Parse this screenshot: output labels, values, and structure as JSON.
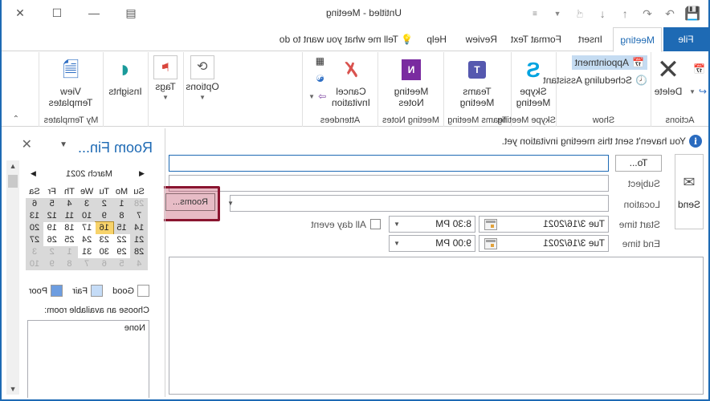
{
  "window": {
    "title": "Untitled  -  Meeting",
    "controls": [
      "restore-ribbon-icon",
      "minimize-icon",
      "maximize-icon",
      "close-icon"
    ]
  },
  "quick_access": [
    "save-icon",
    "redo-icon",
    "undo-icon",
    "up-icon",
    "down-icon",
    "touch-mode-icon",
    "customize-icon"
  ],
  "tabs": [
    {
      "label": "File"
    },
    {
      "label": "Meeting",
      "active": true
    },
    {
      "label": "Insert"
    },
    {
      "label": "Format Text"
    },
    {
      "label": "Review"
    },
    {
      "label": "Help"
    }
  ],
  "tell_me": "Tell me what you want to do",
  "ribbon": {
    "actions": {
      "label": "Actions",
      "delete": "Delete"
    },
    "show": {
      "label": "Show",
      "appointment": "Appointment",
      "scheduling": "Scheduling Assistant"
    },
    "skype": {
      "label": "Skype Meeting",
      "button": [
        "Skype",
        "Meeting"
      ]
    },
    "teams": {
      "label": "Teams Meeting",
      "button": [
        "Teams",
        "Meeting"
      ]
    },
    "notes": {
      "label": "Meeting Notes",
      "button": [
        "Meeting",
        "Notes"
      ]
    },
    "attendees": {
      "label": "Attendees",
      "cancel": [
        "Cancel",
        "Invitation"
      ]
    },
    "options": {
      "label": "Options"
    },
    "tags": {
      "label": "Tags"
    },
    "insights": {
      "label": "Insights"
    },
    "templates": {
      "label": "My Templates",
      "button": [
        "View",
        "Templates"
      ]
    }
  },
  "form": {
    "info": "You haven't sent this meeting invitation yet.",
    "send": "Send",
    "to_button": "To...",
    "to_value": "",
    "subject_label": "Subject",
    "subject_value": "",
    "location_label": "Location",
    "location_value": "",
    "rooms_button": "Rooms...",
    "start_label": "Start time",
    "start_date": "Tue 3/16/2021",
    "start_time": "8:30 PM",
    "end_label": "End time",
    "end_date": "Tue 3/16/2021",
    "end_time": "9:00 PM",
    "all_day_label": "All day event",
    "all_day": false,
    "body": ""
  },
  "room_finder": {
    "title": "Room Fin...",
    "month": "March 2021",
    "dow": [
      "Su",
      "Mo",
      "Tu",
      "We",
      "Th",
      "Fr",
      "Sa"
    ],
    "weeks": [
      [
        "28",
        "1",
        "2",
        "3",
        "4",
        "5",
        "6"
      ],
      [
        "7",
        "8",
        "9",
        "10",
        "11",
        "12",
        "13"
      ],
      [
        "14",
        "15",
        "16",
        "17",
        "18",
        "19",
        "20"
      ],
      [
        "21",
        "22",
        "23",
        "24",
        "25",
        "26",
        "27"
      ],
      [
        "28",
        "29",
        "30",
        "31",
        "1",
        "2",
        "3"
      ],
      [
        "4",
        "5",
        "6",
        "7",
        "8",
        "9",
        "10"
      ]
    ],
    "selected_day": "16",
    "legend": {
      "good": "Good",
      "fair": "Fair",
      "poor": "Poor"
    },
    "colors": {
      "good": "#ffffff",
      "fair": "#c5dcf7",
      "poor": "#6d9de0",
      "selected": "#f7d36b",
      "grey": "#d9d9d9"
    },
    "choose_label": "Choose an available room:",
    "rooms": [
      "None"
    ]
  }
}
